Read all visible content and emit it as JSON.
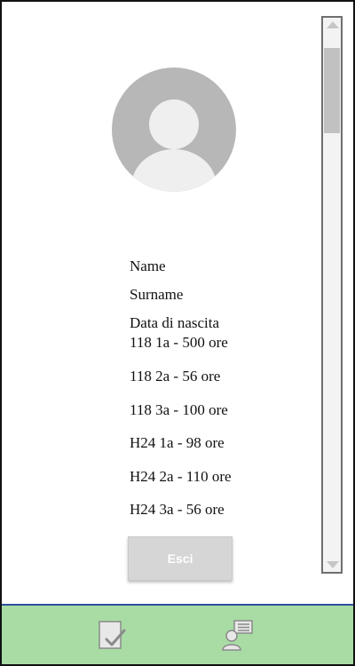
{
  "profile": {
    "avatar_icon": "user-avatar-icon",
    "name": "Name",
    "surname": "Surname",
    "birth_date": "Data di nascita"
  },
  "hours": [
    "118 1a - 500 ore",
    "118 2a - 56 ore",
    "118 3a - 100 ore",
    "H24 1a - 98 ore",
    "H24 2a - 110 ore",
    "H24 3a - 56 ore"
  ],
  "exit_button": {
    "label": "Esci"
  },
  "bottom_nav": {
    "left_icon": "checklist-icon",
    "right_icon": "user-list-icon"
  },
  "colors": {
    "bottom_bar": "#a8dca4",
    "bottom_bar_border": "#2f4fa0",
    "avatar_bg": "#b7b7b7",
    "button_bg": "#d6d6d6"
  }
}
